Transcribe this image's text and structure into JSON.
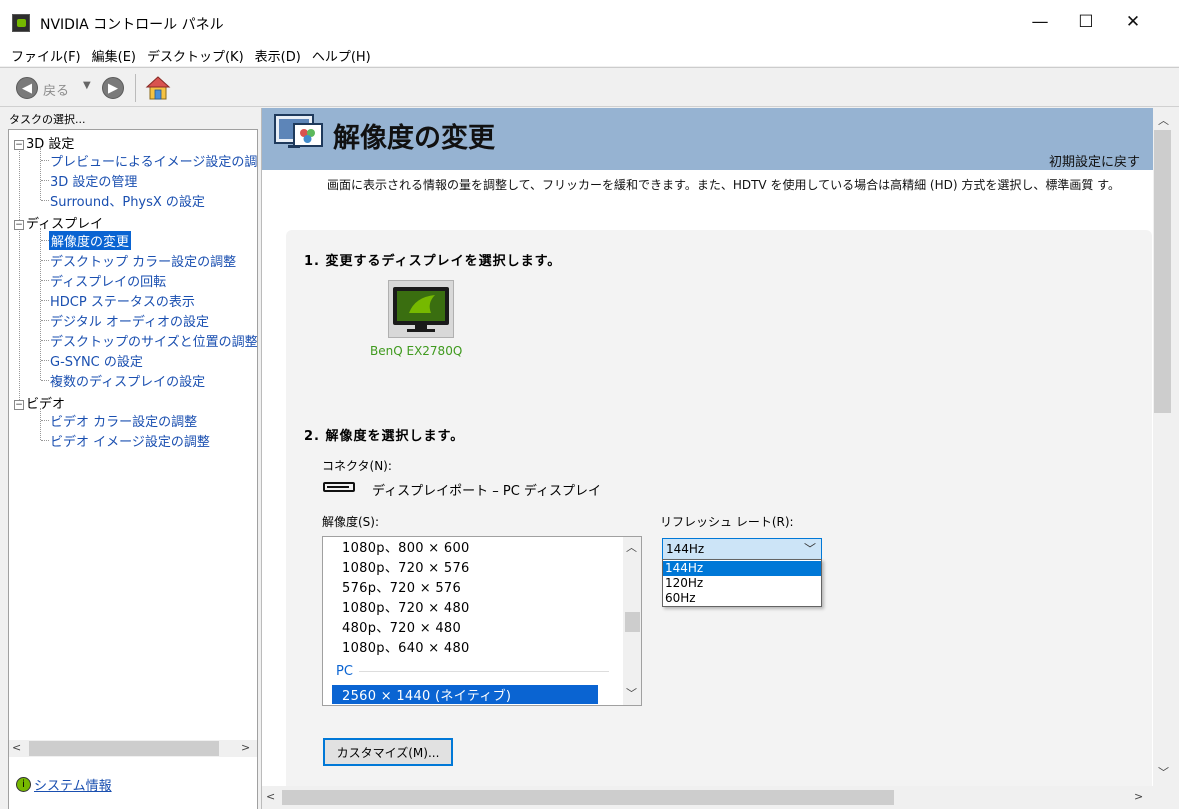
{
  "window": {
    "title": "NVIDIA コントロール パネル",
    "minimize": "—",
    "maximize": "☐",
    "close": "✕"
  },
  "menu": [
    "ファイル(F)",
    "編集(E)",
    "デスクトップ(K)",
    "表示(D)",
    "ヘルプ(H)"
  ],
  "toolbar": {
    "back_label": "戻る",
    "back_arrow": "◀",
    "forward_arrow": "▶",
    "dropdown": "▼"
  },
  "sidebar": {
    "task_label": "タスクの選択...",
    "groups": [
      {
        "label": "3D 設定",
        "toggle": "−",
        "items": [
          "プレビューによるイメージ設定の調整",
          "3D 設定の管理",
          "Surround、PhysX の設定"
        ]
      },
      {
        "label": "ディスプレイ",
        "toggle": "−",
        "items": [
          "解像度の変更",
          "デスクトップ カラー設定の調整",
          "ディスプレイの回転",
          "HDCP ステータスの表示",
          "デジタル オーディオの設定",
          "デスクトップのサイズと位置の調整",
          "G-SYNC の設定",
          "複数のディスプレイの設定"
        ]
      },
      {
        "label": "ビデオ",
        "toggle": "−",
        "items": [
          "ビデオ カラー設定の調整",
          "ビデオ イメージ設定の調整"
        ]
      }
    ],
    "selected_item": "解像度の変更",
    "system_info": "システム情報"
  },
  "main": {
    "title": "解像度の変更",
    "restore_defaults": "初期設定に戻す",
    "description": "画面に表示される情報の量を調整して、フリッカーを緩和できます。また、HDTV を使用している場合は高精細 (HD) 方式を選択し、標準画質 す。",
    "step1": {
      "title": "1. 変更するディスプレイを選択します。",
      "display_name": "BenQ EX2780Q"
    },
    "step2": {
      "title": "2. 解像度を選択します。",
      "connector_label": "コネクタ(N):",
      "connector_value": "ディスプレイポート – PC ディスプレイ",
      "resolution_label": "解像度(S):",
      "resolutions": [
        "1080p、800 × 600",
        "1080p、720 × 576",
        "576p、720 × 576",
        "1080p、720 × 480",
        "480p、720 × 480",
        "1080p、640 × 480"
      ],
      "group_label": "PC",
      "selected_resolution": "2560 × 1440 (ネイティブ)",
      "refresh_label": "リフレッシュ レート(R):",
      "refresh_value": "144Hz",
      "refresh_options": [
        "144Hz",
        "120Hz",
        "60Hz"
      ],
      "customize_button": "カスタマイズ(M)..."
    }
  },
  "colors": {
    "banner": "#96b3d2",
    "selection": "#0a64d2",
    "nvidia_green": "#76b900",
    "link": "#1a4fb0"
  }
}
